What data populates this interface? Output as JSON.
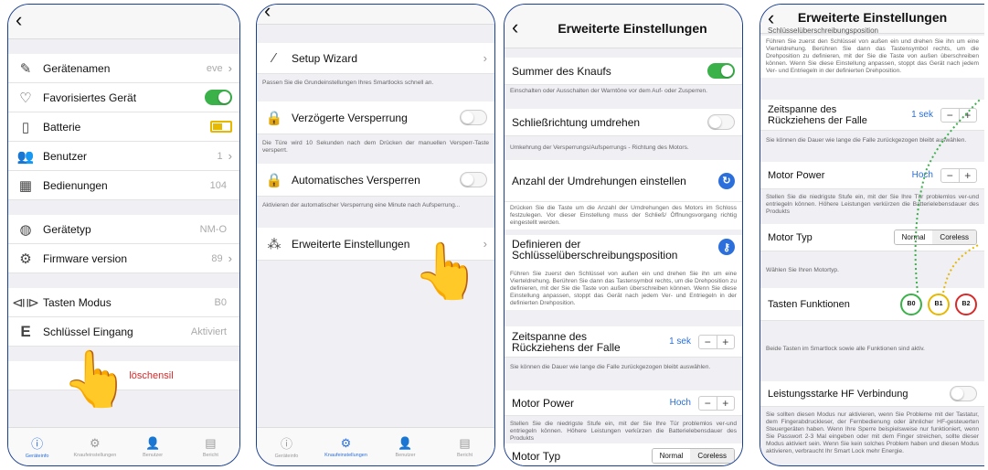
{
  "p1": {
    "rows": [
      {
        "icon": "pencil-icon",
        "label": "Gerätenamen",
        "value": "eve",
        "chev": true
      },
      {
        "icon": "heart-icon",
        "label": "Favorisiertes Gerät",
        "toggle": true
      },
      {
        "icon": "phone-icon",
        "label": "Batterie",
        "battery": true
      },
      {
        "icon": "users-icon",
        "label": "Benutzer",
        "value": "1",
        "chev": true
      },
      {
        "icon": "keypad-icon",
        "label": "Bedienungen",
        "value": "104"
      },
      {
        "icon": "lock-cylinder-icon",
        "label": "Gerätetyp",
        "value": "NM-O"
      },
      {
        "icon": "gears-icon",
        "label": "Firmware version",
        "value": "89",
        "chev": true
      },
      {
        "icon": "arrows-icon",
        "label": "Tasten Modus",
        "value": "B0"
      },
      {
        "icon": "e-icon",
        "label": "Schlüssel Eingang",
        "value": "Aktiviert"
      }
    ],
    "delete": "löschensil",
    "tabs": [
      "Geräteinfo",
      "Knaufeinstellungen",
      "Benutzer",
      "Bericht"
    ]
  },
  "p2": {
    "wizard": "Setup Wizard",
    "wizard_desc": "Passen Sie die Grundeinstellungen Ihres Smartlocks schnell an.",
    "delay": "Verzögerte Versperrung",
    "delay_desc": "Die Türe wird 10 Sekunden nach dem Drücken der manuellen Versperr-Taste versperrt.",
    "auto": "Automatisches Versperren",
    "auto_desc": "Aktivieren der automatischer Versperrung eine Minute nach Aufsperrung...",
    "adv": "Erweiterte Einstellungen",
    "tabs": [
      "Geräteinfo",
      "Knaufeinstellungen",
      "Benutzer",
      "Bericht"
    ]
  },
  "p3": {
    "title": "Erweiterte Einstellungen",
    "summer": "Summer des Knaufs",
    "summer_desc": "Einschalten oder Ausschalten der Warntöne vor dem Auf- oder Zusperren.",
    "dir": "Schließrichtung umdrehen",
    "dir_desc": "Umkehrung der Versperrungs/Aufsperrungs - Richtung des Motors.",
    "turns": "Anzahl der Umdrehungen einstellen",
    "turns_desc": "Drücken Sie die Taste um die Anzahl der Umdrehungen des Motors im Schloss festzulegen. Vor dieser Einstellung muss der Schließ/ Öffnungsvorgang richtig eingestellt werden.",
    "key": "Definieren der Schlüsselüberschreibungsposition",
    "key_desc": "Führen Sie zuerst den Schlüssel von außen ein und drehen Sie ihn um eine Vierteldrehung. Berühren Sie dann das Tastensymbol rechts, um die Drehposition zu definieren, mit der Sie die Taste von außen überschreiben können. Wenn Sie diese Einstellung anpassen, stoppt das Gerät nach jedem Ver- und Entriegeln in der definierten Drehposition.",
    "span": "Zeitspanne des Rückziehens der Falle",
    "span_val": "1 sek",
    "span_desc": "Sie können die Dauer wie lange die Falle zurückgezogen bleibt auswählen.",
    "power": "Motor Power",
    "power_val": "Hoch",
    "power_desc": "Stellen Sie die niedrigste Stufe ein, mit der Sie Ihre Tür problemlos ver-und entriegeln können. Höhere Leistungen verkürzen die Batterielebensdauer des Produkts",
    "typ": "Motor Typ",
    "seg": [
      "Normal",
      "Coreless"
    ]
  },
  "p4": {
    "title": "Erweiterte Einstellungen",
    "top_label": "Schlüsselüberschreibungsposition",
    "key_desc": "Führen Sie zuerst den Schlüssel von außen ein und drehen Sie ihn um eine Vierteldrehung. Berühren Sie dann das Tastensymbol rechts, um die Drehposition zu definieren, mit der Sie die Taste von außen überschreiben können. Wenn Sie diese Einstellung anpassen, stoppt das Gerät nach jedem Ver- und Entriegeln in der definierten Drehposition.",
    "span": "Zeitspanne des Rückziehens der Falle",
    "span_val": "1 sek",
    "span_desc": "Sie können die Dauer wie lange die Falle zurückgezogen bleibt auswählen.",
    "power": "Motor Power",
    "power_val": "Hoch",
    "power_desc": "Stellen Sie die niedrigste Stufe ein, mit der Sie Ihre Tür problemlos ver-und entriegeln können. Höhere Leistungen verkürzen die Batterielebensdauer des Produkts",
    "typ": "Motor Typ",
    "seg": [
      "Normal",
      "Coreless"
    ],
    "typ_desc": "Wählen Sie Ihren Motortyp.",
    "tasten": "Tasten Funktionen",
    "bubbles": [
      "B0",
      "B1",
      "B2"
    ],
    "tasten_desc": "Beide Tasten im Smartlock sowie alle Funktionen sind aktiv.",
    "hf": "Leistungsstarke HF Verbindung",
    "hf_desc": "Sie sollten diesen Modus nur aktivieren, wenn Sie Probleme mit der Tastatur, dem Fingerabdruckleser, der Fernbedienung oder ähnlicher HF-gesteuerten Steuergeräten haben. Wenn Ihre Sperre beispielsweise nur funktioniert, wenn Sie Passwort 2-3 Mal eingeben oder mit dem Finger streichen, sollte dieser Modus aktiviert sein. Wenn Sie kein solches Problem haben und diesen Modus aktivieren, verbraucht Ihr Smart Lock mehr Energie."
  },
  "colors": {
    "accent": "#2a6fdb",
    "green": "#3bb14a",
    "frame": "#1a3f8f",
    "b0": "#3bb14a",
    "b1": "#e6b800",
    "b2": "#d62b2b"
  }
}
